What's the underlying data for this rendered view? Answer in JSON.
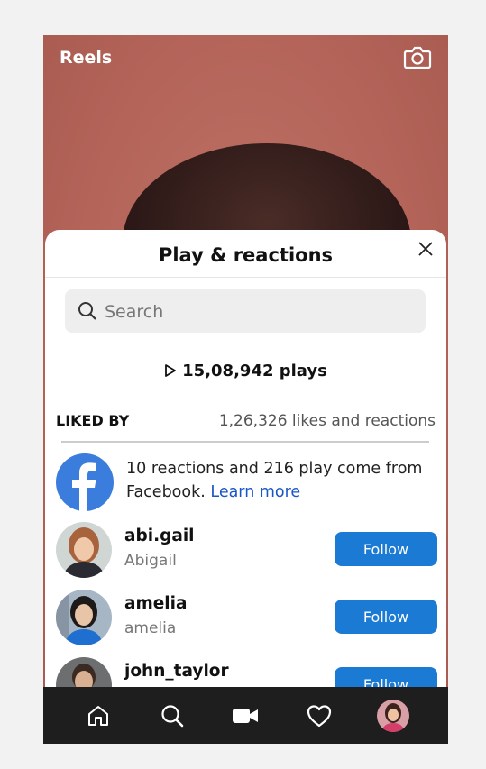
{
  "header": {
    "title": "Reels",
    "camera_icon": "camera-icon"
  },
  "sheet": {
    "title": "Play & reactions",
    "close_icon": "close-icon",
    "search": {
      "placeholder": "Search",
      "value": ""
    },
    "plays": "15,08,942 plays",
    "liked_by_label": "LIKED BY",
    "likes_count": "1,26,326 likes and reactions",
    "facebook": {
      "text": "10 reactions and 216 play come from Facebook.",
      "link": "Learn more"
    },
    "users": [
      {
        "username": "abi.gail",
        "fullname": "Abigail",
        "follow": "Follow"
      },
      {
        "username": "amelia",
        "fullname": "amelia",
        "follow": "Follow"
      },
      {
        "username": "john_taylor",
        "fullname": "",
        "follow": "Follow"
      }
    ]
  },
  "nav": {
    "items": [
      "home-icon",
      "search-icon",
      "video-icon",
      "heart-icon",
      "profile-avatar"
    ]
  },
  "colors": {
    "accent": "#1a7ad4",
    "link": "#1a56c8",
    "nav_bg": "#1e1e1e",
    "facebook_blue": "#3b7ddd"
  }
}
